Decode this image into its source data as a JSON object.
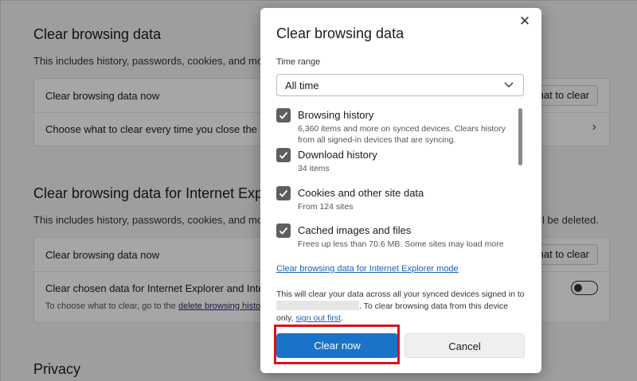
{
  "background": {
    "section1": {
      "title": "Clear browsing data",
      "desc": "This includes history, passwords, cookies, and more.",
      "row1": "Clear browsing data now",
      "row1_btn": "what to clear",
      "row2": "Choose what to clear every time you close the b"
    },
    "section2": {
      "title": "Clear browsing data for Internet Exp",
      "desc": "This includes history, passwords, cookies, and more.",
      "desc_right": "l be deleted.",
      "row1": "Clear browsing data now",
      "row1_btn": "what to clear",
      "row2": "Clear chosen data for Internet Explorer and Inter",
      "row2_small_prefix": "To choose what to clear, go to the",
      "row2_small_link": "delete browsing history"
    },
    "section3": {
      "title": "Privacy"
    }
  },
  "dialog": {
    "title": "Clear browsing data",
    "time_range_label": "Time range",
    "time_range_value": "All time",
    "items": [
      {
        "title": "Browsing history",
        "sub": "6,360 items and more on synced devices. Clears history from all signed-in devices that are syncing.",
        "checked": true
      },
      {
        "title": "Download history",
        "sub": "34 items",
        "checked": true
      },
      {
        "title": "Cookies and other site data",
        "sub": "From 124 sites",
        "checked": true
      },
      {
        "title": "Cached images and files",
        "sub": "Frees up less than 70.6 MB. Some sites may load more",
        "checked": true
      }
    ],
    "ie_link": "Clear browsing data for Internet Explorer mode",
    "sync_note_1": "This will clear your data across all your synced devices signed in to",
    "sync_note_2": ". To clear browsing data from this device only,",
    "sync_note_link": "sign out first",
    "sync_note_end": ".",
    "clear_button": "Clear now",
    "cancel_button": "Cancel"
  },
  "colors": {
    "accent": "#1a73c9",
    "highlight": "#d8131b"
  }
}
